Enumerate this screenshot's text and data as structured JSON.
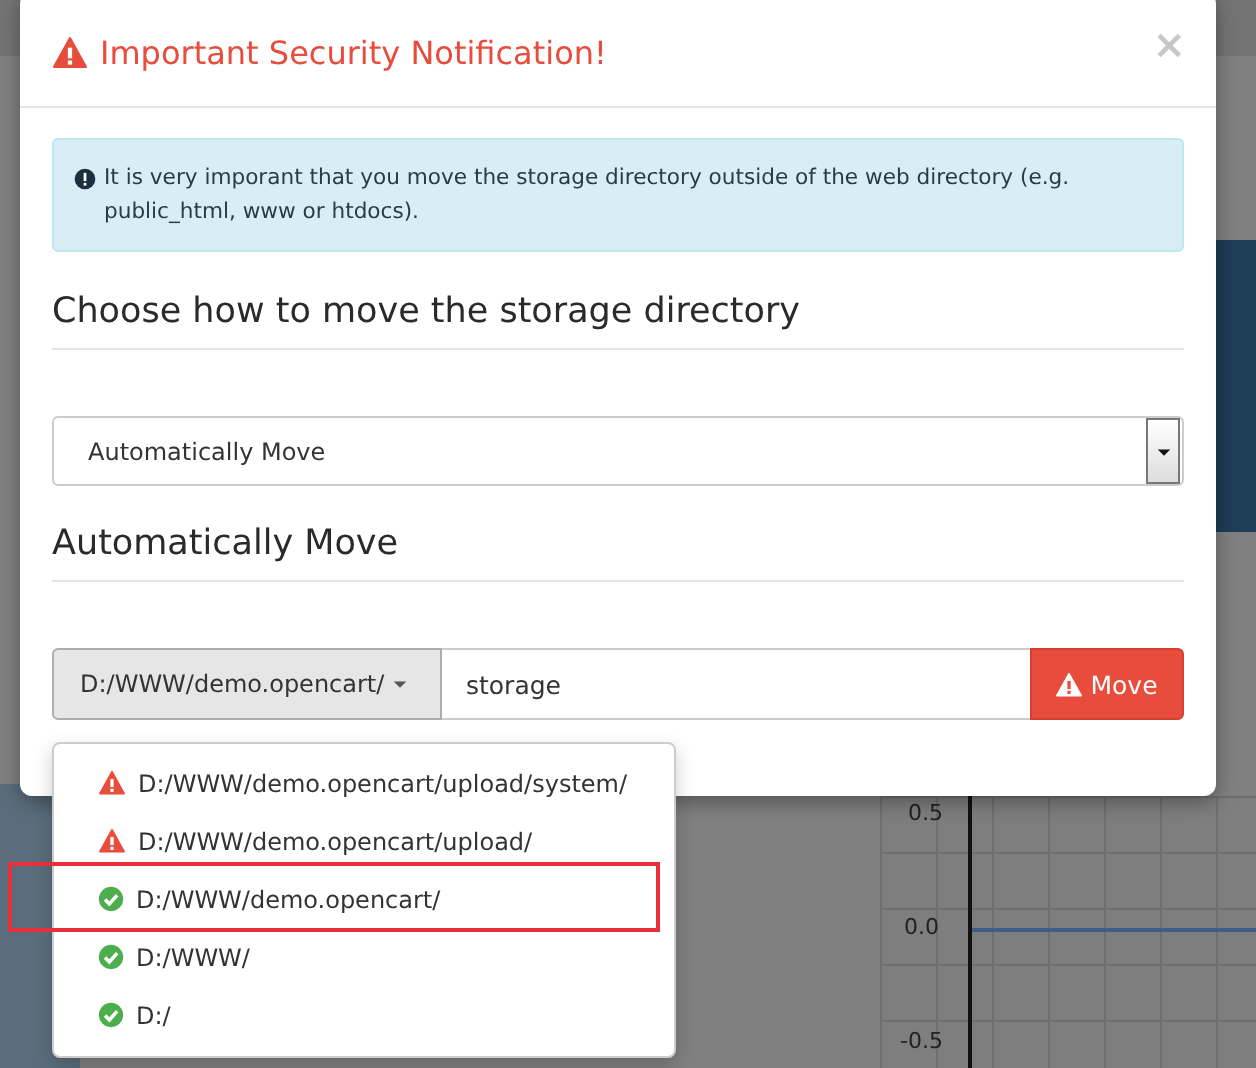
{
  "modal": {
    "title": "Important Security Notification!",
    "close": "×",
    "alert": "It is very imporant that you move the storage directory outside of the web directory (e.g. public_html, www or htdocs).",
    "section_heading": "Choose how to move the storage directory",
    "method_select": {
      "value": "Automatically Move"
    },
    "subheading": "Automatically Move",
    "path_button": "D:/WWW/demo.opencart/",
    "folder_input": {
      "value": "storage"
    },
    "move_button": "Move",
    "path_menu": [
      {
        "path": "D:/WWW/demo.opencart/upload/system/",
        "kind": "warning",
        "highlighted": false
      },
      {
        "path": "D:/WWW/demo.opencart/upload/",
        "kind": "warning",
        "highlighted": false
      },
      {
        "path": "D:/WWW/demo.opencart/",
        "kind": "ok",
        "highlighted": true
      },
      {
        "path": "D:/WWW/",
        "kind": "ok",
        "highlighted": false
      },
      {
        "path": "D:/",
        "kind": "ok",
        "highlighted": false
      }
    ]
  },
  "background_chart": {
    "axis_labels": [
      "0.5",
      "0.0",
      "-0.5"
    ]
  }
}
